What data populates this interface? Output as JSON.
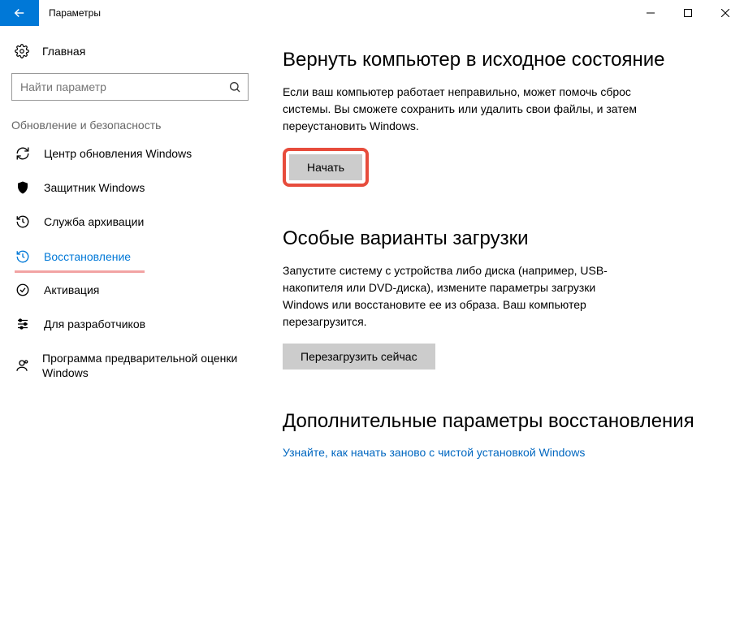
{
  "titlebar": {
    "title": "Параметры"
  },
  "sidebar": {
    "home": "Главная",
    "search_placeholder": "Найти параметр",
    "group": "Обновление и безопасность",
    "items": [
      {
        "label": "Центр обновления Windows"
      },
      {
        "label": "Защитник Windows"
      },
      {
        "label": "Служба архивации"
      },
      {
        "label": "Восстановление"
      },
      {
        "label": "Активация"
      },
      {
        "label": "Для разработчиков"
      },
      {
        "label": "Программа предварительной оценки Windows"
      }
    ]
  },
  "main": {
    "reset": {
      "heading": "Вернуть компьютер в исходное состояние",
      "desc": "Если ваш компьютер работает неправильно, может помочь сброс системы. Вы сможете сохранить или удалить свои файлы, и затем переустановить Windows.",
      "button": "Начать"
    },
    "advanced_boot": {
      "heading": "Особые варианты загрузки",
      "desc": "Запустите систему с устройства либо диска (например, USB-накопителя или DVD-диска), измените параметры загрузки Windows или восстановите ее из образа. Ваш компьютер перезагрузится.",
      "button": "Перезагрузить сейчас"
    },
    "more": {
      "heading": "Дополнительные параметры восстановления",
      "link": "Узнайте, как начать заново с чистой установкой Windows"
    }
  }
}
